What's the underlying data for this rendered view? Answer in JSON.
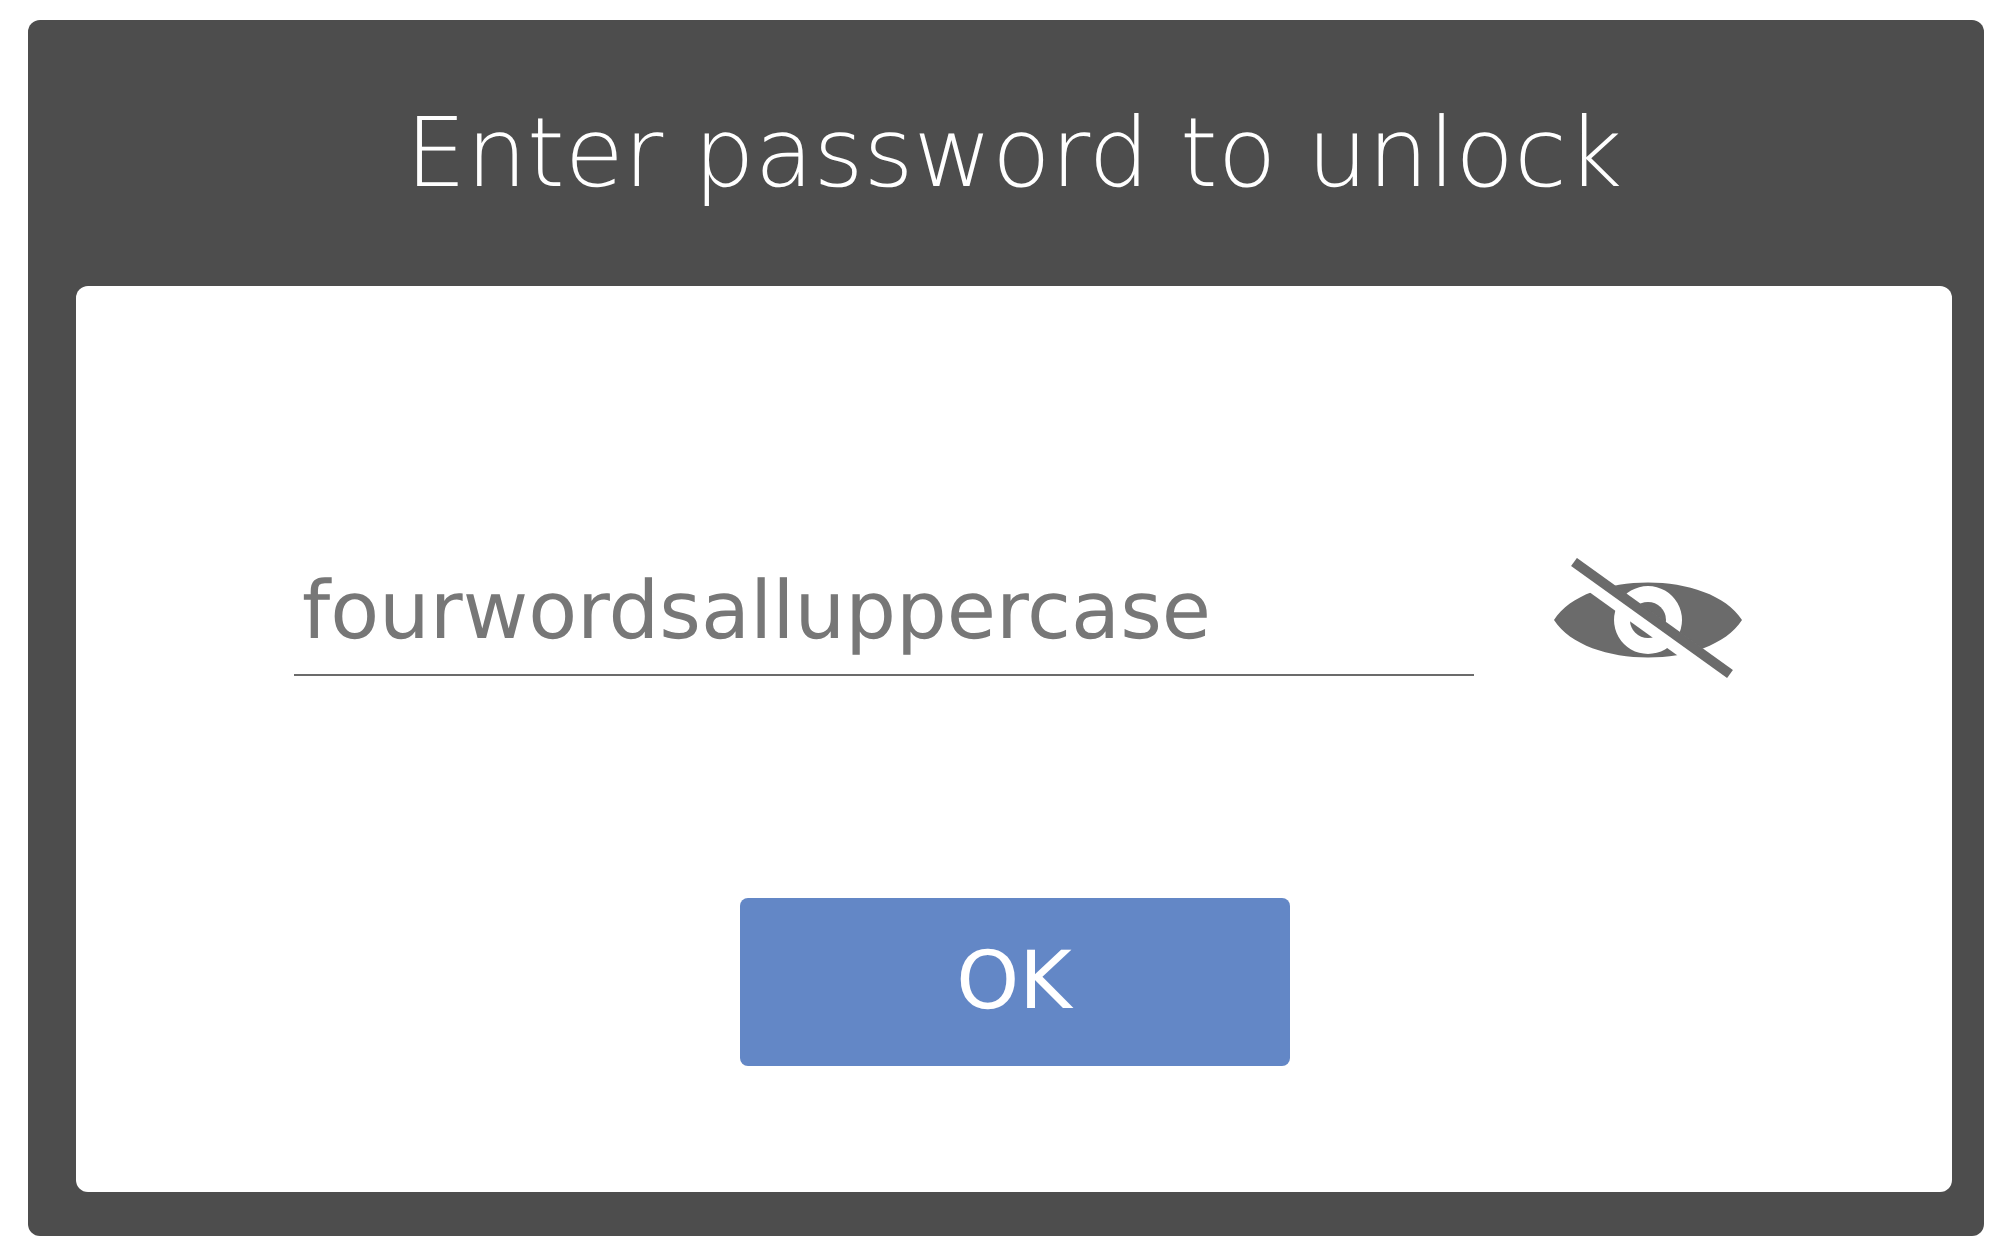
{
  "dialog": {
    "title": "Enter password to unlock"
  },
  "password_field": {
    "value": "fourwordsalluppercase"
  },
  "buttons": [
    "OK"
  ]
}
